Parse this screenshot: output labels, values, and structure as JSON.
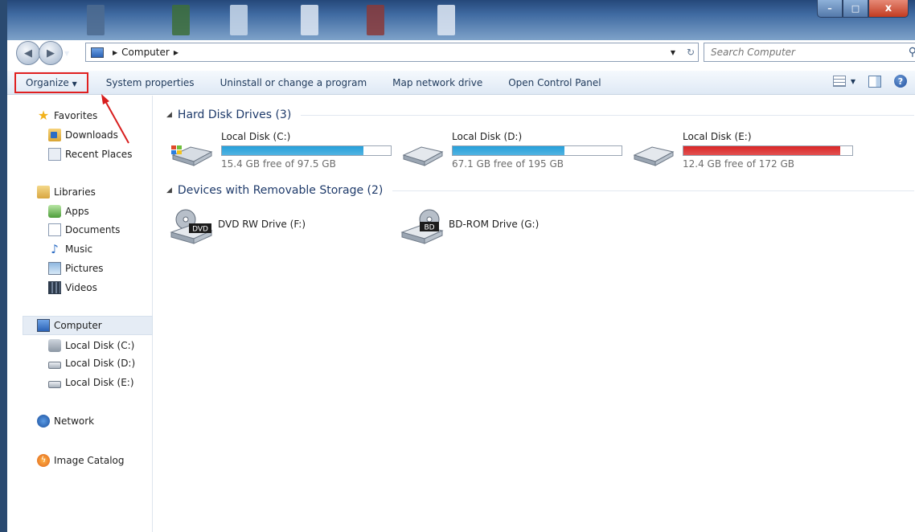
{
  "window": {
    "caption_buttons": {
      "minimize": "–",
      "maximize": "□",
      "close": "x"
    }
  },
  "address": {
    "root_icon": "computer-icon",
    "location": "Computer"
  },
  "search": {
    "placeholder": "Search Computer"
  },
  "toolbar": {
    "items": [
      "Organize",
      "System properties",
      "Uninstall or change a program",
      "Map network drive",
      "Open Control Panel"
    ],
    "organize_highlight_color": "#e02020"
  },
  "sidebar": {
    "favorites": {
      "label": "Favorites",
      "items": [
        "Downloads",
        "Recent Places"
      ]
    },
    "libraries": {
      "label": "Libraries",
      "items": [
        "Apps",
        "Documents",
        "Music",
        "Pictures",
        "Videos"
      ]
    },
    "computer": {
      "label": "Computer",
      "items": [
        "Local Disk (C:)",
        "Local Disk (D:)",
        "Local Disk (E:)"
      ]
    },
    "network": {
      "label": "Network"
    },
    "image_catalog": {
      "label": "Image Catalog"
    }
  },
  "content": {
    "hard_disk_header": "Hard Disk Drives (3)",
    "removable_header": "Devices with Removable Storage (2)",
    "drives": [
      {
        "name": "Local Disk (C:)",
        "free": "15.4 GB free of 97.5 GB",
        "used_fraction": 0.84,
        "bar_color": "#26a0da"
      },
      {
        "name": "Local Disk (D:)",
        "free": "67.1 GB free of 195 GB",
        "used_fraction": 0.66,
        "bar_color": "#26a0da"
      },
      {
        "name": "Local Disk (E:)",
        "free": "12.4 GB free of 172 GB",
        "used_fraction": 0.93,
        "bar_color": "#da2626"
      }
    ],
    "devices": [
      {
        "name": "DVD RW Drive (F:)",
        "badge": "DVD"
      },
      {
        "name": "BD-ROM Drive (G:)",
        "badge": "BD"
      }
    ]
  }
}
